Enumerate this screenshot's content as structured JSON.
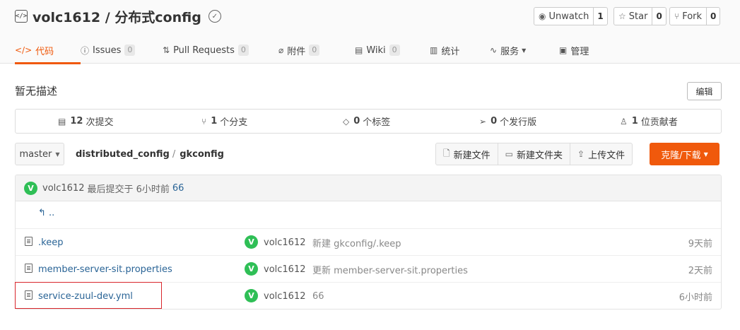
{
  "repo": {
    "title": "volc1612 / 分布式config"
  },
  "actions": {
    "watch": {
      "label": "Unwatch",
      "count": "1"
    },
    "star": {
      "label": "Star",
      "count": "0"
    },
    "fork": {
      "label": "Fork",
      "count": "0"
    }
  },
  "tabs": [
    {
      "label": "代码",
      "count": ""
    },
    {
      "label": "Issues",
      "count": "0"
    },
    {
      "label": "Pull Requests",
      "count": "0"
    },
    {
      "label": "附件",
      "count": "0"
    },
    {
      "label": "Wiki",
      "count": "0"
    },
    {
      "label": "统计",
      "count": ""
    },
    {
      "label": "服务",
      "count": ""
    },
    {
      "label": "管理",
      "count": ""
    }
  ],
  "description": "暂无描述",
  "edit_label": "编辑",
  "stats": {
    "commits": {
      "num": "12",
      "label": "次提交"
    },
    "branches": {
      "num": "1",
      "label": "个分支"
    },
    "tags": {
      "num": "0",
      "label": "个标签"
    },
    "releases": {
      "num": "0",
      "label": "个发行版"
    },
    "contributors": {
      "num": "1",
      "label": "位贡献者"
    }
  },
  "branch": {
    "name": "master"
  },
  "breadcrumb": {
    "root": "distributed_config",
    "sep": "/",
    "dir": "gkconfig"
  },
  "file_actions": {
    "new_file": "新建文件",
    "new_folder": "新建文件夹",
    "upload": "上传文件",
    "clone": "克隆/下载"
  },
  "last_commit": {
    "avatar": "V",
    "author": "volc1612",
    "text": "最后提交于 6小时前",
    "message": "66"
  },
  "parent_dir": "..",
  "files": [
    {
      "name": ".keep",
      "avatar": "V",
      "author": "volc1612",
      "message": "新建 gkconfig/.keep",
      "time": "9天前"
    },
    {
      "name": "member-server-sit.properties",
      "avatar": "V",
      "author": "volc1612",
      "message": "更新 member-server-sit.properties",
      "time": "2天前"
    },
    {
      "name": "service-zuul-dev.yml",
      "avatar": "V",
      "author": "volc1612",
      "message": "66",
      "time": "6小时前"
    }
  ]
}
